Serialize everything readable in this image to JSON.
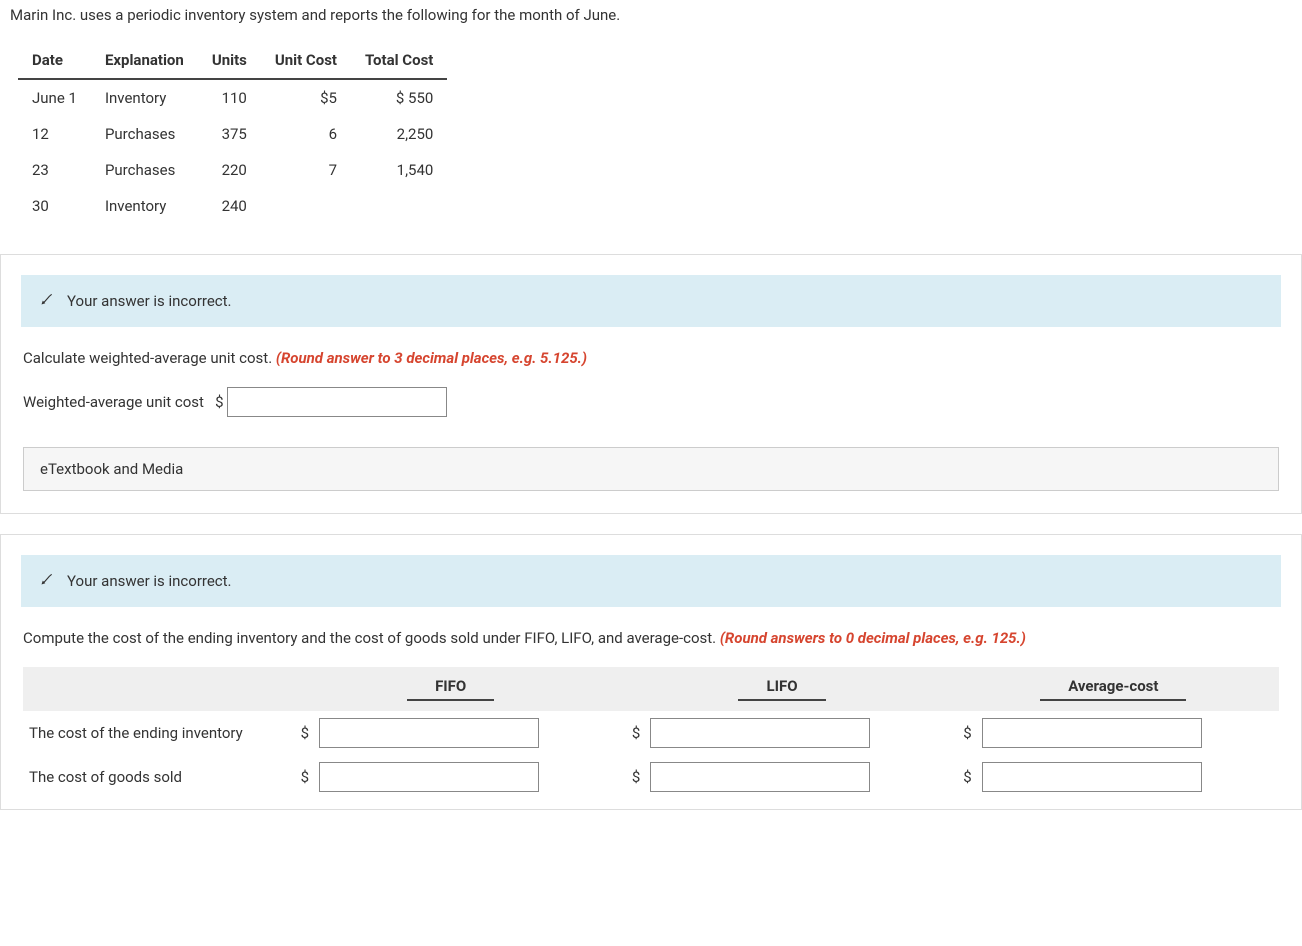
{
  "problem": {
    "intro": "Marin Inc. uses a periodic inventory system and reports the following for the month of June.",
    "headers": {
      "date": "Date",
      "explanation": "Explanation",
      "units": "Units",
      "unit_cost": "Unit Cost",
      "total_cost": "Total Cost"
    },
    "rows": [
      {
        "date": "June 1",
        "explanation": "Inventory",
        "units": "110",
        "unit_cost": "$5",
        "total_cost": "$ 550"
      },
      {
        "date": "12",
        "explanation": "Purchases",
        "units": "375",
        "unit_cost": "6",
        "total_cost": "2,250"
      },
      {
        "date": "23",
        "explanation": "Purchases",
        "units": "220",
        "unit_cost": "7",
        "total_cost": "1,540"
      },
      {
        "date": "30",
        "explanation": "Inventory",
        "units": "240",
        "unit_cost": "",
        "total_cost": ""
      }
    ]
  },
  "alert_text": "Your answer is incorrect.",
  "part1": {
    "instruction_plain": "Calculate weighted-average unit cost. ",
    "instruction_hint": "(Round answer to 3 decimal places, e.g. 5.125.)",
    "input_label": "Weighted-average unit cost",
    "currency": "$"
  },
  "etextbook_label": "eTextbook and Media",
  "part2": {
    "instruction_plain": "Compute the cost of the ending inventory and the cost of goods sold under FIFO, LIFO, and average-cost. ",
    "instruction_hint": "(Round answers to 0 decimal places, e.g. 125.)",
    "col_headers": {
      "fifo": "FIFO",
      "lifo": "LIFO",
      "avg": "Average-cost"
    },
    "row_labels": {
      "ending_inv": "The cost of the ending inventory",
      "cogs": "The cost of goods sold"
    },
    "currency": "$"
  }
}
